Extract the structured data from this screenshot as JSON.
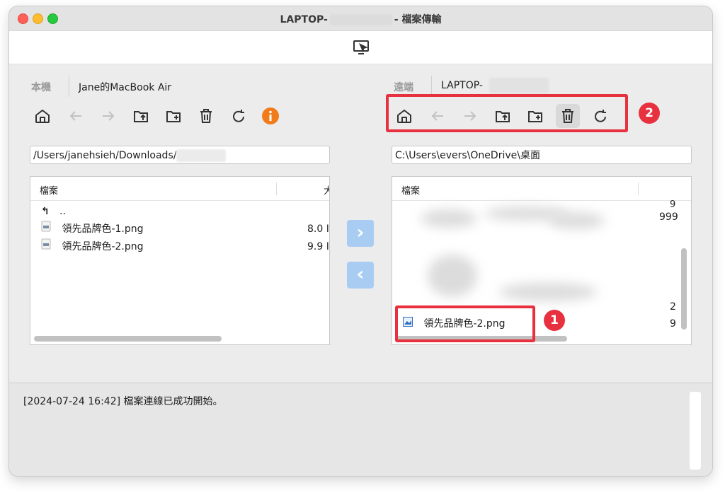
{
  "window": {
    "title_prefix": "LAPTOP-",
    "title_suffix": "- 檔案傳輸"
  },
  "local": {
    "side_label": "本機",
    "computer_name": "Jane的MacBook Air",
    "path": "/Users/janehsieh/Downloads/",
    "col_file": "檔案",
    "col_size": "大",
    "parent_entry": "..",
    "files": [
      {
        "name": "領先品牌色-1.png",
        "size": "8.0 I"
      },
      {
        "name": "領先品牌色-2.png",
        "size": "9.9 I"
      }
    ]
  },
  "remote": {
    "side_label": "遠端",
    "computer_name": "LAPTOP-",
    "path": "C:\\Users\\evers\\OneDrive\\桌面",
    "col_file": "檔案",
    "partial_sizes": [
      "9",
      "999",
      "2",
      "9"
    ],
    "highlighted_file": {
      "name": "領先品牌色-2.png"
    }
  },
  "transfer": {
    "send_glyph": "›",
    "receive_glyph": "‹"
  },
  "log": {
    "message": "[2024-07-24 16:42] 檔案連線已成功開始。"
  },
  "annotations": {
    "badge_1": "1",
    "badge_2": "2"
  },
  "colors": {
    "annotation_red": "#e8313f",
    "info_orange": "#f07c1c",
    "transfer_blue": "#a9cdf2"
  },
  "icons": [
    "home-icon",
    "back-arrow-icon",
    "forward-arrow-icon",
    "folder-up-icon",
    "new-folder-icon",
    "trash-icon",
    "refresh-icon",
    "info-icon",
    "screen-share-icon"
  ]
}
